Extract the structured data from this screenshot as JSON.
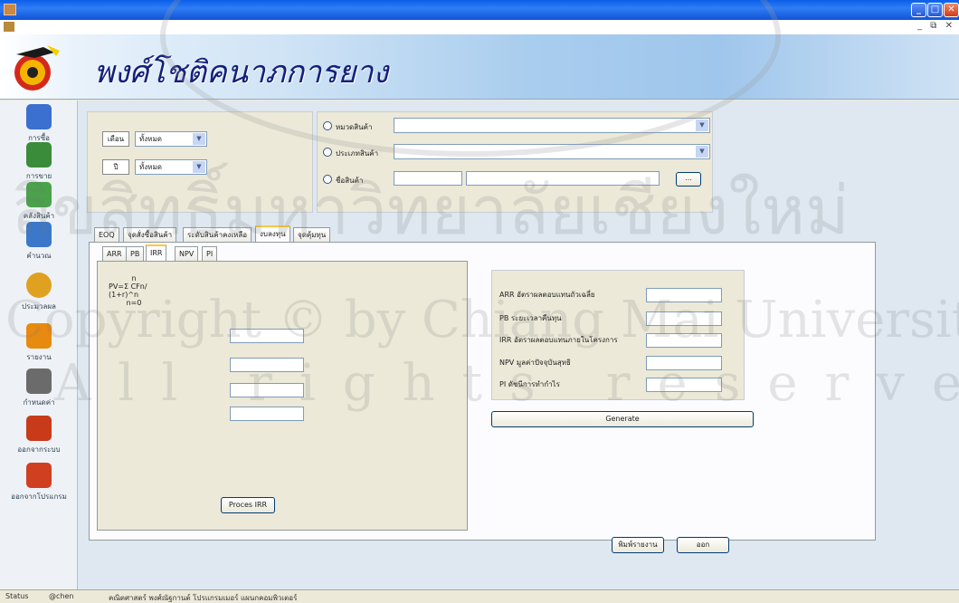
{
  "window": {
    "min": "_",
    "max": "□",
    "close": "✕",
    "mdi_controls": "_ ⧉ ✕"
  },
  "banner": {
    "title": "พงศ์โชติคนาภการยาง"
  },
  "sidebar": {
    "items": [
      {
        "label": "การซื้อ",
        "color": "#3b6fd0"
      },
      {
        "label": "การขาย",
        "color": "#3a8c3a"
      },
      {
        "label": "คลังสินค้า",
        "color": "#4aa34a"
      },
      {
        "label": "คำนวณ",
        "color": "#3b78c9"
      },
      {
        "label": "ประมวลผล",
        "color": "#e0a020"
      },
      {
        "label": "รายงาน",
        "color": "#e88a10"
      },
      {
        "label": "กำหนดค่า",
        "color": "#6b6b6b"
      },
      {
        "label": "ออกจากระบบ",
        "color": "#c83a1a"
      },
      {
        "label": "ออกจากโปรแกรม",
        "color": "#d04020"
      }
    ]
  },
  "filters": {
    "month_label": "เดือน",
    "month_value": "ทั้งหมด",
    "year_label": "ปี",
    "year_value": "ทั้งหมด",
    "radio_category": "หมวดสินค้า",
    "radio_type": "ประเภทสินค้า",
    "radio_product": "ชื่อสินค้า",
    "browse": "..."
  },
  "tabs": [
    "EOQ",
    "จุดสั่งซื้อสินค้า",
    "ระดับสินค้าคงเหลือ",
    "งบลงทุน",
    "จุดคุ้มทุน"
  ],
  "active_tab": 3,
  "subtabs": [
    "ARR",
    "PB",
    "IRR",
    "NPV",
    "PI"
  ],
  "active_subtab": 2,
  "irr": {
    "formula_top": "n",
    "formula_main": "PV=Σ CFn/ (1+r)^n",
    "formula_bottom": "n=0",
    "process_button": "Proces IRR"
  },
  "results": {
    "rows": [
      {
        "label": "ARR อัตราผลตอบแทนถัวเฉลี่ย"
      },
      {
        "label": "PB ระยะเวลาคืนทุน"
      },
      {
        "label": "IRR อัตราผลตอบแทนภายในโครงการ"
      },
      {
        "label": "NPV มูลค่าปัจจุบันสุทธิ"
      },
      {
        "label": "PI ดัชนีการทำกำไร"
      }
    ],
    "generate": "Generate"
  },
  "footer_buttons": {
    "print": "พิมพ์รายงาน",
    "exit": "ออก"
  },
  "status": {
    "label": "Status",
    "user": "@chen",
    "message": "คณิตศาสตร์ พงศ์ณัฐกานต์ โปรแกรมเมอร์ แผนกคอมพิวเตอร์"
  },
  "watermark": {
    "line1": "ลิขสิทธิ์มหาวิทยาลัยเชียงใหม่",
    "line2": "Copyright © by Chiang Mai University",
    "line3": "All rights reserved"
  }
}
